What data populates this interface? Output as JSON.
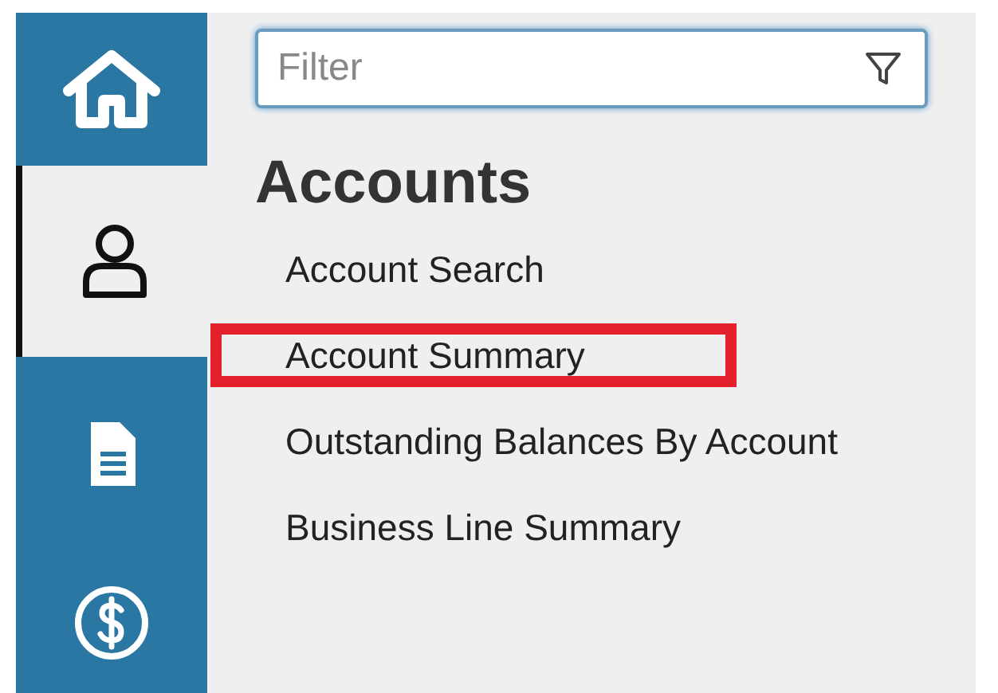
{
  "nav": [
    {
      "kind": "home",
      "selected": false
    },
    {
      "kind": "person",
      "selected": true
    },
    {
      "kind": "document",
      "selected": false
    },
    {
      "kind": "dollar",
      "selected": false
    }
  ],
  "filter": {
    "placeholder": "Filter"
  },
  "section": {
    "title": "Accounts",
    "items": [
      {
        "label": "Account Search",
        "highlighted": false
      },
      {
        "label": "Account Summary",
        "highlighted": true
      },
      {
        "label": "Outstanding Balances By Account",
        "highlighted": false
      },
      {
        "label": "Business Line Summary",
        "highlighted": false
      }
    ]
  }
}
